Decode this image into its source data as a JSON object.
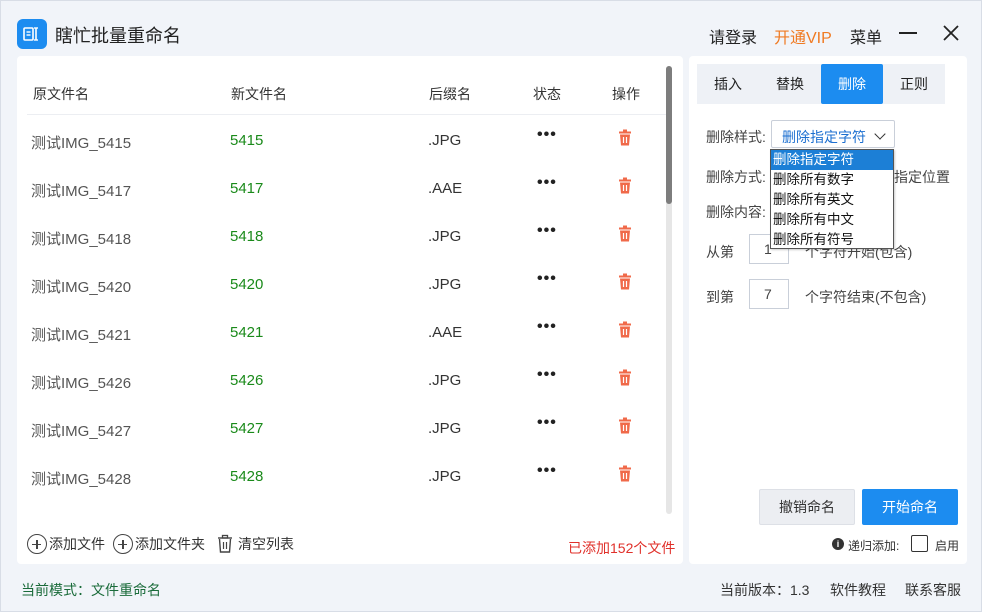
{
  "app": {
    "title": "瞎忙批量重命名",
    "login": "请登录",
    "vip": "开通VIP",
    "menu": "菜单"
  },
  "colors": {
    "accent": "#1c8cf0",
    "vip": "#f07a22",
    "new_name": "#1a8a1a",
    "delete_icon": "#f06a4a",
    "count": "#e0302a"
  },
  "table": {
    "headers": {
      "orig": "原文件名",
      "new": "新文件名",
      "ext": "后缀名",
      "status": "状态",
      "action": "操作"
    },
    "rows": [
      {
        "orig": "测试IMG_5415",
        "new": "5415",
        "ext": ".JPG",
        "more": "•••"
      },
      {
        "orig": "测试IMG_5417",
        "new": "5417",
        "ext": ".AAE",
        "more": "•••"
      },
      {
        "orig": "测试IMG_5418",
        "new": "5418",
        "ext": ".JPG",
        "more": "•••"
      },
      {
        "orig": "测试IMG_5420",
        "new": "5420",
        "ext": ".JPG",
        "more": "•••"
      },
      {
        "orig": "测试IMG_5421",
        "new": "5421",
        "ext": ".AAE",
        "more": "•••"
      },
      {
        "orig": "测试IMG_5426",
        "new": "5426",
        "ext": ".JPG",
        "more": "•••"
      },
      {
        "orig": "测试IMG_5427",
        "new": "5427",
        "ext": ".JPG",
        "more": "•••"
      },
      {
        "orig": "测试IMG_5428",
        "new": "5428",
        "ext": ".JPG",
        "more": "•••"
      }
    ]
  },
  "actions": {
    "add_file": "添加文件",
    "add_folder": "添加文件夹",
    "clear_list": "清空列表",
    "added_count": "已添加152个文件"
  },
  "tabs": [
    {
      "label": "插入",
      "active": false
    },
    {
      "label": "替换",
      "active": false
    },
    {
      "label": "删除",
      "active": true
    },
    {
      "label": "正则",
      "active": false
    }
  ],
  "form": {
    "style_label": "删除样式:",
    "style_value": "删除指定字符",
    "method_label": "删除方式:",
    "method_tail": "指定位置",
    "content_label": "删除内容:",
    "from_label": "从第",
    "from_value": "1",
    "from_tail": "个字符开始(包含)",
    "to_label": "到第",
    "to_value": "7",
    "to_tail": "个字符结束(不包含)"
  },
  "dropdown": {
    "options": [
      "删除指定字符",
      "删除所有数字",
      "删除所有英文",
      "删除所有中文",
      "删除所有符号"
    ],
    "selected": "删除指定字符"
  },
  "buttons": {
    "cancel": "撤销命名",
    "start": "开始命名",
    "info": "i",
    "recursive": "递归添加:",
    "enable": "启用"
  },
  "status": {
    "mode": "当前模式：文件重命名",
    "version": "当前版本：1.3",
    "tutorial": "软件教程",
    "service": "联系客服"
  }
}
